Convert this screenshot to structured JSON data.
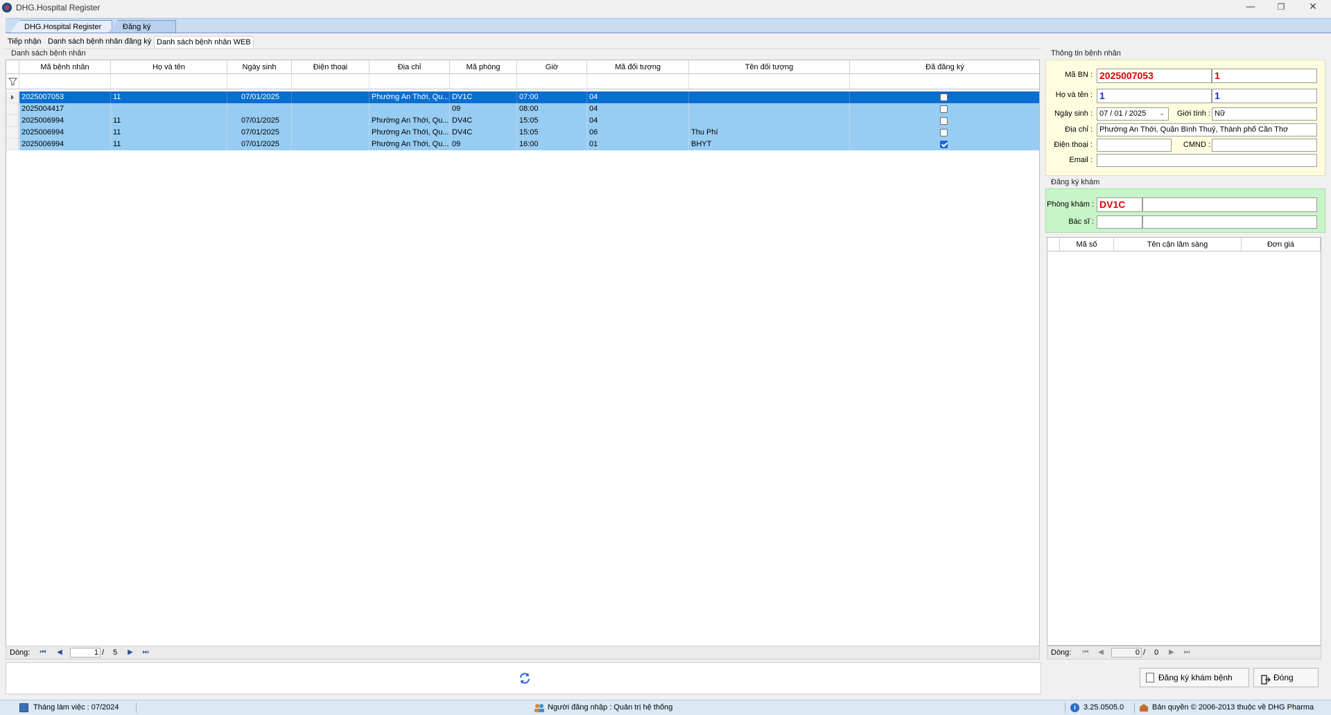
{
  "window": {
    "title": "DHG.Hospital Register"
  },
  "doc_tabs": [
    "DHG.Hospital Register",
    "Đăng ký KCB"
  ],
  "sub_tabs": [
    "Tiếp nhận",
    "Danh sách bệnh nhân đăng ký",
    "Danh sách bệnh nhân WEB"
  ],
  "left_group": {
    "title": "Danh sách bệnh nhân"
  },
  "grid": {
    "columns": [
      "Mã bệnh nhân",
      "Họ và tên",
      "Ngày sinh",
      "Điện thoại",
      "Địa chỉ",
      "Mã phòng",
      "Giờ",
      "Mã đối tượng",
      "Tên đối tượng",
      "Đã đăng ký"
    ],
    "rows": [
      {
        "ma_bn": "2025007053",
        "ho_ten": "11",
        "ngay_sinh": "07/01/2025",
        "dien_thoai": "",
        "dia_chi": "Phường An Thới, Qu...",
        "ma_phong": "DV1C",
        "gio": "07:00",
        "ma_dt": "04",
        "ten_dt": "",
        "da_dk": false
      },
      {
        "ma_bn": "2025004417",
        "ho_ten": "",
        "ngay_sinh": "",
        "dien_thoai": "",
        "dia_chi": "",
        "ma_phong": "09",
        "gio": "08:00",
        "ma_dt": "04",
        "ten_dt": "",
        "da_dk": false
      },
      {
        "ma_bn": "2025006994",
        "ho_ten": "11",
        "ngay_sinh": "07/01/2025",
        "dien_thoai": "",
        "dia_chi": "Phường An Thới, Qu...",
        "ma_phong": "DV4C",
        "gio": "15:05",
        "ma_dt": "04",
        "ten_dt": "",
        "da_dk": false
      },
      {
        "ma_bn": "2025006994",
        "ho_ten": "11",
        "ngay_sinh": "07/01/2025",
        "dien_thoai": "",
        "dia_chi": "Phường An Thới, Qu...",
        "ma_phong": "DV4C",
        "gio": "15:05",
        "ma_dt": "06",
        "ten_dt": "Thu Phí",
        "da_dk": false
      },
      {
        "ma_bn": "2025006994",
        "ho_ten": "11",
        "ngay_sinh": "07/01/2025",
        "dien_thoai": "",
        "dia_chi": "Phường An Thới, Qu...",
        "ma_phong": "09",
        "gio": "16:00",
        "ma_dt": "01",
        "ten_dt": "BHYT",
        "da_dk": true
      }
    ]
  },
  "pager_left": {
    "label": "Dòng:",
    "current": "1",
    "sep": "/",
    "total": "5"
  },
  "patient_info": {
    "title": "Thông tin bệnh nhân",
    "ma_bn_label": "Mã BN :",
    "ma_bn": "2025007053",
    "ma_bn_2": "1",
    "ho_ten_label": "Họ và tên :",
    "ho_ten": "1",
    "ho_ten_2": "1",
    "ngay_sinh_label": "Ngày sinh :",
    "ngay_sinh": "07 / 01 / 2025",
    "gioi_tinh_label": "Giới tính :",
    "gioi_tinh": "Nữ",
    "dia_chi_label": "Địa chỉ :",
    "dia_chi": "Phường An Thới, Quận Bình Thuỷ, Thành phố Cần Thơ",
    "dien_thoai_label": "Điện thoại :",
    "dien_thoai": "",
    "cmnd_label": "CMND :",
    "cmnd": "",
    "email_label": "Email :",
    "email": ""
  },
  "registration": {
    "title": "Đăng ký khám",
    "phong_kham_label": "Phòng khám :",
    "phong_kham": "DV1C",
    "phong_kham_name": "",
    "bac_si_label": "Bác sĩ :",
    "bac_si": "",
    "bac_si_name": ""
  },
  "lab_grid": {
    "columns": [
      "Mã số",
      "Tên cận lâm sàng",
      "Đơn giá"
    ]
  },
  "pager_right": {
    "label": "Dòng:",
    "current": "0",
    "sep": "/",
    "total": "0"
  },
  "buttons": {
    "register": "Đăng ký khám bệnh",
    "close": "Đóng"
  },
  "status": {
    "month": "Tháng làm việc : 07/2024",
    "user": "Người đăng nhập : Quản trị hệ thống",
    "version": "3.25.0505.0",
    "copyright": "Bản quyền © 2006-2013 thuộc về DHG Pharma"
  },
  "colors": {
    "selected_row": "#0a6ecf",
    "row": "#98cdf3",
    "patient_panel": "#fffde0",
    "register_panel": "#c8f5c8",
    "required_text": "#e00000"
  },
  "icons": [
    "app-icon",
    "minimize-icon",
    "restore-icon",
    "close-icon",
    "filter-icon",
    "row-pointer-icon",
    "first-page-icon",
    "prev-page-icon",
    "next-page-icon",
    "last-page-icon",
    "refresh-icon",
    "dropdown-icon",
    "register-icon",
    "exit-icon",
    "calendar-icon",
    "users-icon",
    "info-icon",
    "copyright-icon"
  ]
}
